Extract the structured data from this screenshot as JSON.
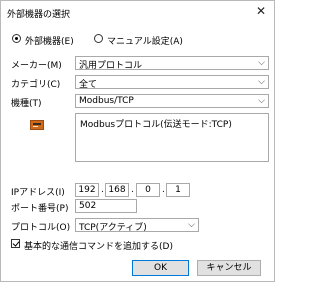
{
  "window": {
    "title": "外部機器の選択",
    "close_glyph": "✕"
  },
  "mode": {
    "external_label": "外部機器(E)",
    "manual_label": "マニュアル設定(A)",
    "selected": "external"
  },
  "maker": {
    "label": "メーカー(M)",
    "value": "汎用プロトコル"
  },
  "category": {
    "label": "カテゴリ(C)",
    "value": "全て"
  },
  "model": {
    "label": "機種(T)",
    "value": "Modbus/TCP",
    "icon": "plc-device-icon"
  },
  "description": "Modbusプロトコル(伝送モード:TCP)",
  "ip": {
    "label": "IPアドレス(I)",
    "octets": [
      "192",
      "168",
      "0",
      "1"
    ],
    "separator": "."
  },
  "port": {
    "label": "ポート番号(P)",
    "value": "502"
  },
  "protocol": {
    "label": "プロトコル(O)",
    "value": "TCP(アクティブ)"
  },
  "add_basic": {
    "label": "基本的な通信コマンドを追加する(D)",
    "checked": true
  },
  "buttons": {
    "ok": "OK",
    "cancel": "キャンセル"
  },
  "glyphs": {
    "dropdown": "⌵"
  }
}
